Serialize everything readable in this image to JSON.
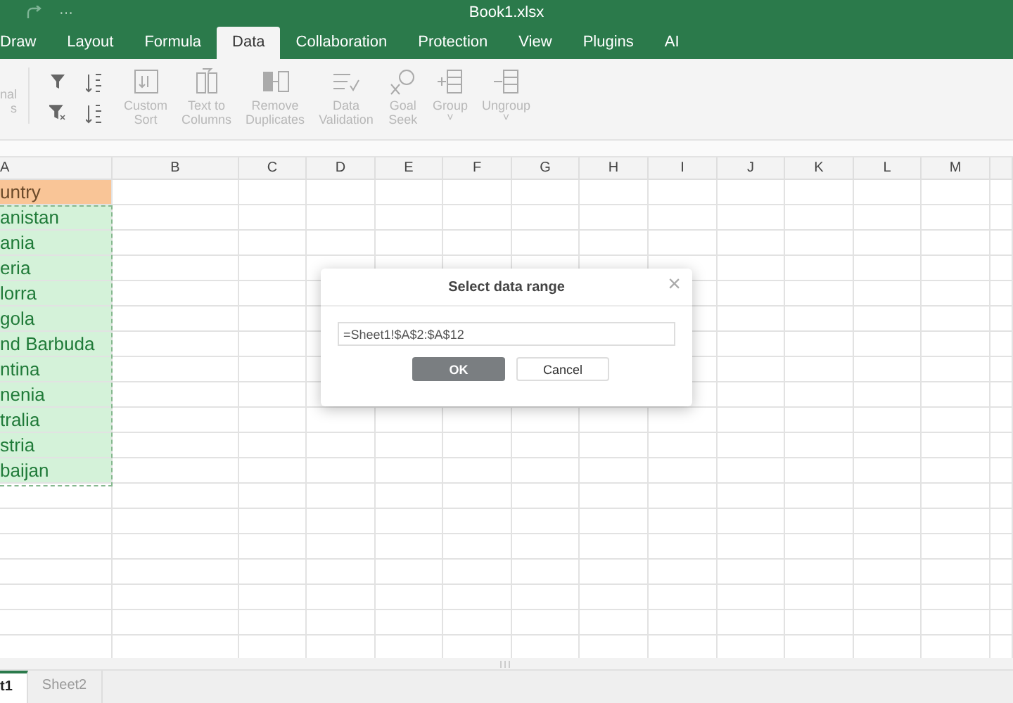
{
  "window": {
    "title": "Book1.xlsx",
    "more": "···"
  },
  "tabs": [
    {
      "label": "Draw",
      "selected": false
    },
    {
      "label": "Layout",
      "selected": false
    },
    {
      "label": "Formula",
      "selected": false
    },
    {
      "label": "Data",
      "selected": true
    },
    {
      "label": "Collaboration",
      "selected": false
    },
    {
      "label": "Protection",
      "selected": false
    },
    {
      "label": "View",
      "selected": false
    },
    {
      "label": "Plugins",
      "selected": false
    },
    {
      "label": "AI",
      "selected": false
    }
  ],
  "toolbar": [
    {
      "kind": "partial",
      "lines": [
        "nal",
        "s"
      ],
      "disabled": true
    },
    {
      "kind": "filters",
      "disabled": false
    },
    {
      "kind": "button",
      "lines": [
        "Custom",
        "Sort"
      ],
      "disabled": true
    },
    {
      "kind": "button",
      "lines": [
        "Text to",
        "Columns"
      ],
      "disabled": true
    },
    {
      "kind": "button",
      "lines": [
        "Remove",
        "Duplicates"
      ],
      "disabled": true
    },
    {
      "kind": "button",
      "lines": [
        "Data",
        "Validation"
      ],
      "disabled": true
    },
    {
      "kind": "button",
      "lines": [
        "Goal",
        "Seek"
      ],
      "disabled": true
    },
    {
      "kind": "button",
      "lines": [
        "Group"
      ],
      "caret": "˅",
      "disabled": true
    },
    {
      "kind": "button",
      "lines": [
        "Ungroup"
      ],
      "caret": "˅",
      "disabled": true
    }
  ],
  "sheet": {
    "columns": [
      "A",
      "B",
      "C",
      "D",
      "E",
      "F",
      "G",
      "H",
      "I",
      "J",
      "K",
      "L",
      "M"
    ],
    "cells": [
      {
        "text": "untry",
        "kind": "header"
      },
      {
        "text": "anistan",
        "kind": "data"
      },
      {
        "text": "ania",
        "kind": "data"
      },
      {
        "text": "eria",
        "kind": "data"
      },
      {
        "text": "lorra",
        "kind": "data"
      },
      {
        "text": "gola",
        "kind": "data"
      },
      {
        "text": "nd Barbuda",
        "kind": "data"
      },
      {
        "text": "ntina",
        "kind": "data"
      },
      {
        "text": "nenia",
        "kind": "data"
      },
      {
        "text": "tralia",
        "kind": "data"
      },
      {
        "text": "stria",
        "kind": "data"
      },
      {
        "text": "baijan",
        "kind": "data"
      }
    ]
  },
  "dialog": {
    "title": "Select data range",
    "close": "×",
    "value": "=Sheet1!$A$2:$A$12",
    "buttons": [
      {
        "label": "OK",
        "kind": "primary"
      },
      {
        "label": "Cancel",
        "kind": "secondary"
      }
    ]
  },
  "sheet_tabs": [
    {
      "label": "t1",
      "selected": true
    },
    {
      "label": "Sheet2",
      "selected": false
    }
  ]
}
